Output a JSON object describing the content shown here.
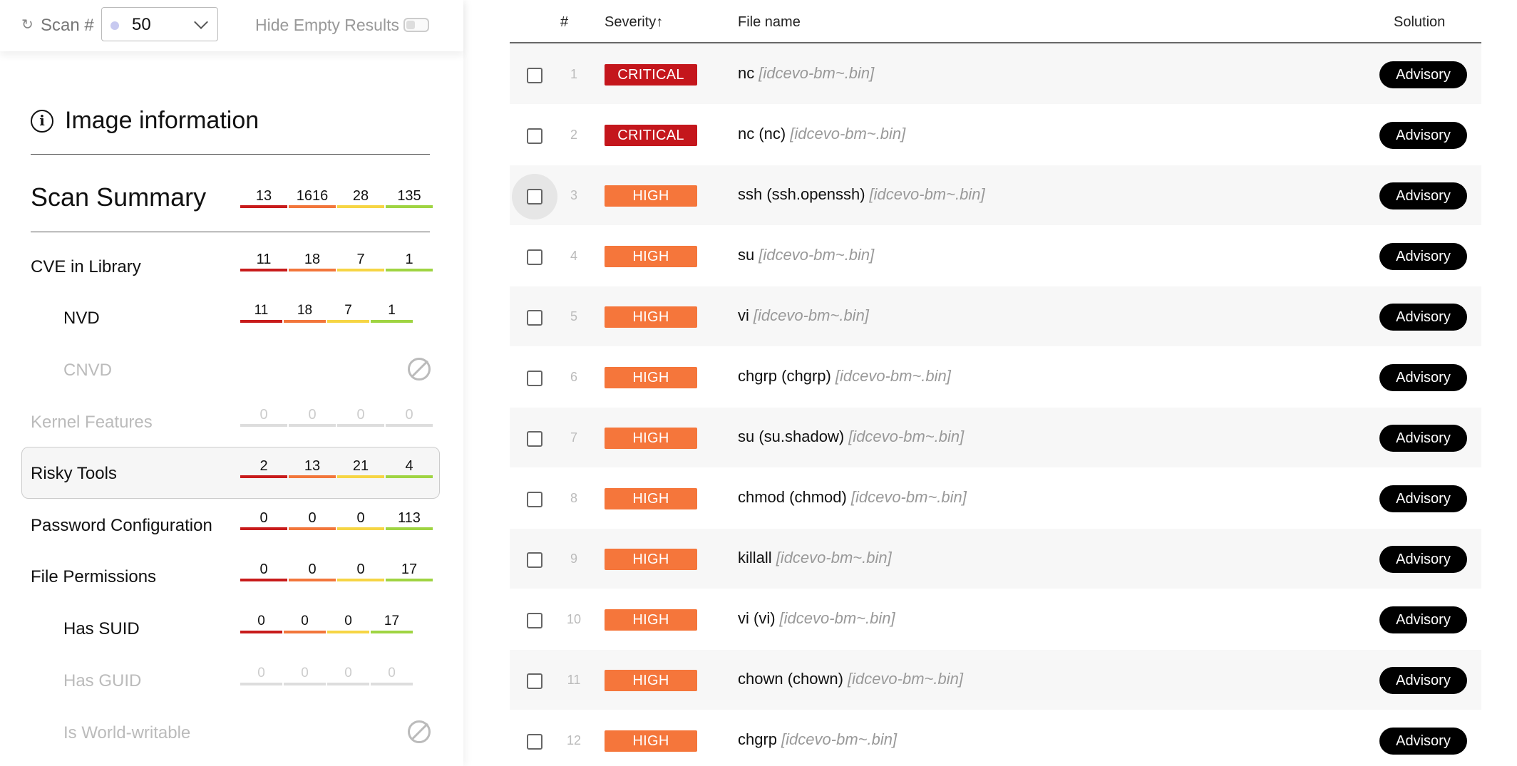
{
  "topbar": {
    "scan_label": "Scan #",
    "scan_value": "50",
    "hide_empty_label": "Hide Empty Results",
    "hide_empty_on": false
  },
  "image_info": {
    "title": "Image information"
  },
  "summary": {
    "title": "Scan Summary",
    "values": [
      "13",
      "1616",
      "28",
      "135"
    ]
  },
  "severity_colors": [
    "#c81b1b",
    "#f2763b",
    "#f6d544",
    "#9fd442"
  ],
  "rows": [
    {
      "label": "CVE in Library",
      "values": [
        "11",
        "18",
        "7",
        "1"
      ]
    },
    {
      "label": "NVD",
      "values": [
        "11",
        "18",
        "7",
        "1"
      ]
    },
    {
      "label": "CNVD",
      "values": []
    },
    {
      "label": "Kernel Features",
      "values": [
        "0",
        "0",
        "0",
        "0"
      ]
    },
    {
      "label": "Risky Tools",
      "values": [
        "2",
        "13",
        "21",
        "4"
      ]
    },
    {
      "label": "Password Configuration",
      "values": [
        "0",
        "0",
        "0",
        "113"
      ]
    },
    {
      "label": "File Permissions",
      "values": [
        "0",
        "0",
        "0",
        "17"
      ]
    },
    {
      "label": "Has SUID",
      "values": [
        "0",
        "0",
        "0",
        "17"
      ]
    },
    {
      "label": "Has GUID",
      "values": [
        "0",
        "0",
        "0",
        "0"
      ]
    },
    {
      "label": "Is World-writable",
      "values": []
    }
  ],
  "table": {
    "headers": {
      "num": "#",
      "severity": "Severity",
      "sort_icon": "sort-ascending-icon",
      "file": "File name",
      "solution": "Solution"
    },
    "rows": [
      {
        "num": "1",
        "severity": "CRITICAL",
        "name": "nc",
        "source": "[idcevo-bm~.bin]",
        "solution": "Advisory"
      },
      {
        "num": "2",
        "severity": "CRITICAL",
        "name": "nc (nc)",
        "source": "[idcevo-bm~.bin]",
        "solution": "Advisory"
      },
      {
        "num": "3",
        "severity": "HIGH",
        "name": "ssh (ssh.openssh)",
        "source": "[idcevo-bm~.bin]",
        "solution": "Advisory"
      },
      {
        "num": "4",
        "severity": "HIGH",
        "name": "su",
        "source": "[idcevo-bm~.bin]",
        "solution": "Advisory"
      },
      {
        "num": "5",
        "severity": "HIGH",
        "name": "vi",
        "source": "[idcevo-bm~.bin]",
        "solution": "Advisory"
      },
      {
        "num": "6",
        "severity": "HIGH",
        "name": "chgrp (chgrp)",
        "source": "[idcevo-bm~.bin]",
        "solution": "Advisory"
      },
      {
        "num": "7",
        "severity": "HIGH",
        "name": "su (su.shadow)",
        "source": "[idcevo-bm~.bin]",
        "solution": "Advisory"
      },
      {
        "num": "8",
        "severity": "HIGH",
        "name": "chmod (chmod)",
        "source": "[idcevo-bm~.bin]",
        "solution": "Advisory"
      },
      {
        "num": "9",
        "severity": "HIGH",
        "name": "killall",
        "source": "[idcevo-bm~.bin]",
        "solution": "Advisory"
      },
      {
        "num": "10",
        "severity": "HIGH",
        "name": "vi (vi)",
        "source": "[idcevo-bm~.bin]",
        "solution": "Advisory"
      },
      {
        "num": "11",
        "severity": "HIGH",
        "name": "chown (chown)",
        "source": "[idcevo-bm~.bin]",
        "solution": "Advisory"
      },
      {
        "num": "12",
        "severity": "HIGH",
        "name": "chgrp",
        "source": "[idcevo-bm~.bin]",
        "solution": "Advisory"
      }
    ]
  },
  "badge_colors": {
    "CRITICAL": "#c4161c",
    "HIGH": "#f5763b"
  }
}
